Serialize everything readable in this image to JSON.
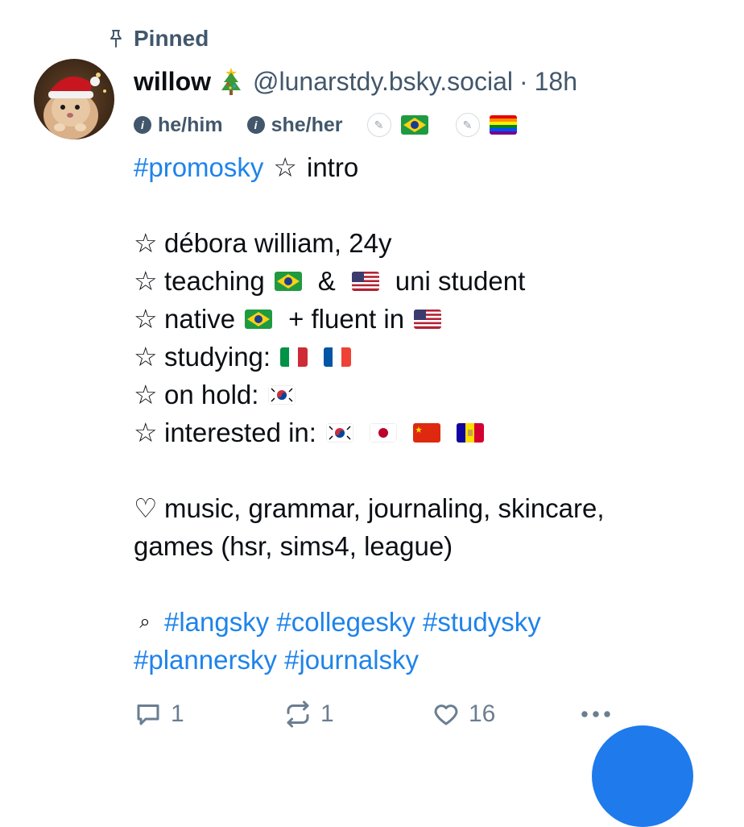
{
  "post": {
    "pinned_label": "Pinned",
    "author": {
      "display_name": "willow",
      "name_emoji": "christmas-tree",
      "handle": "@lunarstdy.bsky.social",
      "separator": "·",
      "time": "18h"
    },
    "labels": [
      "he/him",
      "she/her"
    ],
    "label_chips": [
      {
        "icon": "lang-badge-icon",
        "flag": "brazil"
      },
      {
        "icon": "lang-badge-icon",
        "flag": "rainbow"
      }
    ],
    "text": {
      "hashtag_promo": "#promosky",
      "intro": "intro",
      "star": "☆",
      "line_name": "débora william, 24y",
      "line_teaching_a": "teaching",
      "line_teaching_b": "&",
      "line_teaching_c": "uni student",
      "line_native_a": "native",
      "line_native_b": "+ fluent in",
      "line_studying": "studying:",
      "line_hold": "on hold:",
      "line_interested": "interested in:",
      "heart": "♡",
      "interests_1": "music, grammar, journaling, skincare,",
      "interests_2": "games (hsr, sims4, league)",
      "search_glyph": "⌕",
      "tags_1": "#langsky #collegesky #studysky",
      "tags_2": "#plannersky #journalsky"
    },
    "counts": {
      "replies": "1",
      "reposts": "1",
      "likes": "16"
    }
  },
  "colors": {
    "muted": "#42576c",
    "link": "#1e83ea",
    "fab": "#1f7aec"
  }
}
